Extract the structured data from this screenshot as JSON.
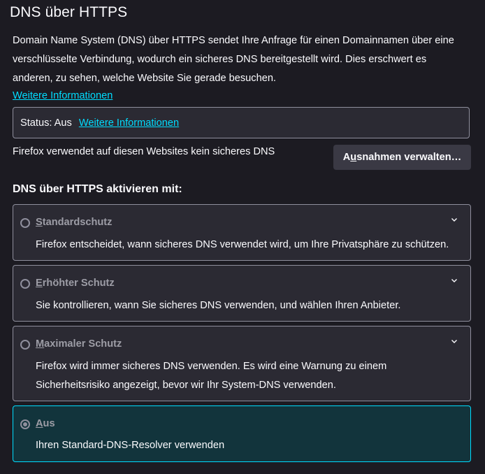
{
  "header": {
    "title": "DNS über HTTPS"
  },
  "intro": {
    "description": "Domain Name System (DNS) über HTTPS sendet Ihre Anfrage für einen Domainnamen über eine verschlüsselte Verbindung, wodurch ein sicheres DNS bereitgestellt wird. Dies erschwert es anderen, zu sehen, welche Website Sie gerade besuchen.",
    "more_info_label": "Weitere Informationen"
  },
  "status": {
    "text": "Status: Aus",
    "more_info_label": "Weitere Informationen"
  },
  "exceptions": {
    "text": "Firefox verwendet auf diesen Websites kein sicheres DNS",
    "button_label_pre": "A",
    "button_label_mnemonic": "u",
    "button_label_post": "snahmen verwalten…"
  },
  "section": {
    "heading": "DNS über HTTPS aktivieren mit:"
  },
  "options": [
    {
      "label_mnemonic": "S",
      "label_rest": "tandardschutz",
      "description": "Firefox entscheidet, wann sicheres DNS verwendet wird, um Ihre Privatsphäre zu schützen.",
      "selected": false
    },
    {
      "label_mnemonic": "E",
      "label_rest": "rhöhter Schutz",
      "description": "Sie kontrollieren, wann Sie sicheres DNS verwenden, und wählen Ihren Anbieter.",
      "selected": false
    },
    {
      "label_mnemonic": "M",
      "label_rest": "aximaler Schutz",
      "description": "Firefox wird immer sicheres DNS verwenden. Es wird eine Warnung zu einem Sicherheitsrisiko angezeigt, bevor wir Ihr System-DNS verwenden.",
      "selected": false
    },
    {
      "label_mnemonic": "A",
      "label_rest": "us",
      "description": "Ihren Standard-DNS-Resolver verwenden",
      "selected": true
    }
  ],
  "colors": {
    "background": "#1c1b22",
    "card": "#2b2a33",
    "accent": "#00ddff",
    "selected_card": "#12343c",
    "border": "#8f8f9d"
  },
  "icons": {
    "expand": "chevron-down-icon",
    "radio": "radio-icon"
  }
}
